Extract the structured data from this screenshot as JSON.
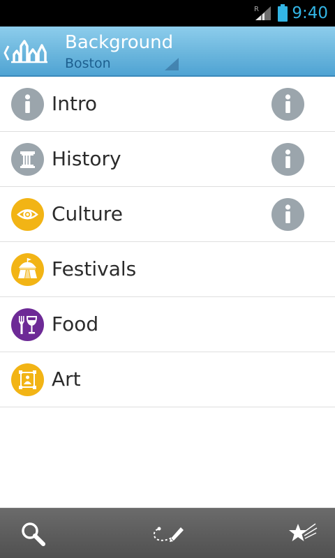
{
  "status_bar": {
    "clock": "9:40",
    "roaming_indicator": "R",
    "icons": [
      "signal-icon",
      "battery-icon"
    ],
    "accent_color": "#33b5e5"
  },
  "action_bar": {
    "title": "Background",
    "subtitle": "Boston",
    "up_icon": "app-logo-icon",
    "colors": {
      "top": "#8dcdec",
      "bottom": "#4fa3d3",
      "subtitle": "#1d5f8f"
    }
  },
  "list": {
    "items": [
      {
        "label": "Intro",
        "icon": "info-icon",
        "icon_color": "#9ba5ac",
        "has_info_button": true
      },
      {
        "label": "History",
        "icon": "column-icon",
        "icon_color": "#9ba5ac",
        "has_info_button": true
      },
      {
        "label": "Culture",
        "icon": "eye-icon",
        "icon_color": "#f2b415",
        "has_info_button": true
      },
      {
        "label": "Festivals",
        "icon": "tent-icon",
        "icon_color": "#f2b415",
        "has_info_button": false
      },
      {
        "label": "Food",
        "icon": "fork-wine-icon",
        "icon_color": "#6d2a96",
        "has_info_button": false
      },
      {
        "label": "Art",
        "icon": "frame-icon",
        "icon_color": "#f2b415",
        "has_info_button": false
      }
    ]
  },
  "bottom_bar": {
    "tabs": [
      {
        "icon": "search-icon"
      },
      {
        "icon": "route-edit-icon"
      },
      {
        "icon": "favorites-star-icon"
      }
    ]
  }
}
